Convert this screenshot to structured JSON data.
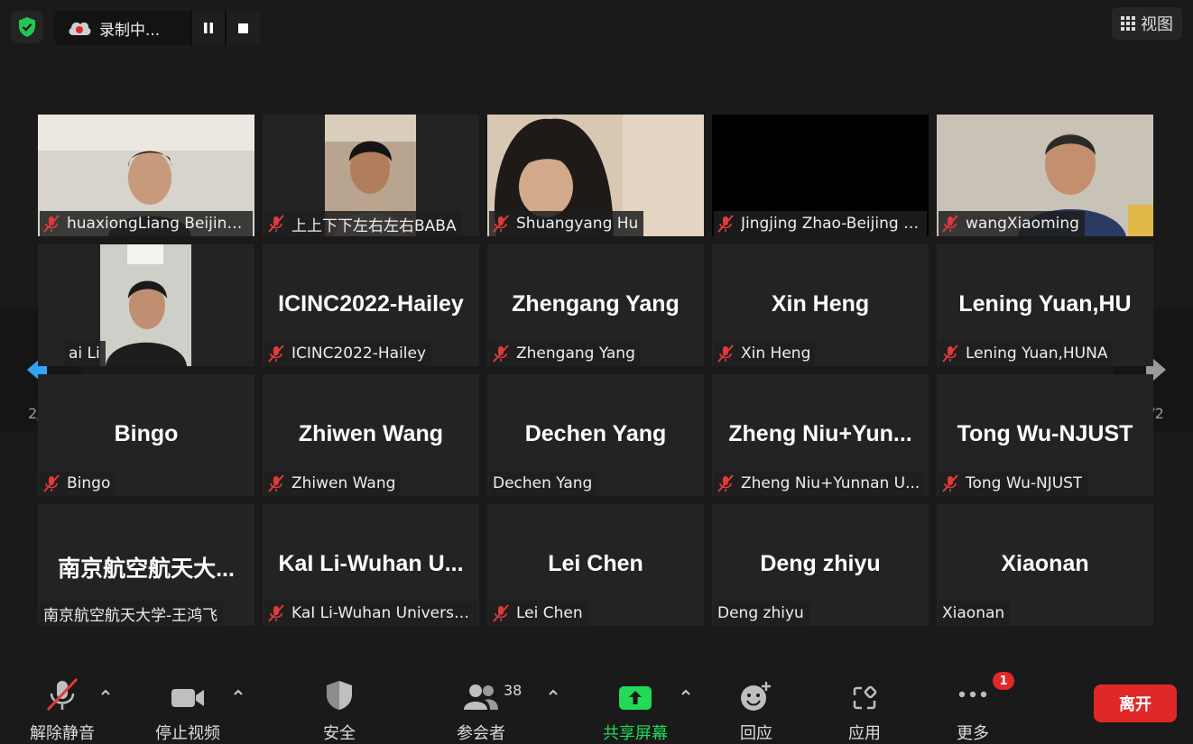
{
  "recording": {
    "label": "录制中..."
  },
  "view_button": {
    "label": "视图"
  },
  "pagination": {
    "left": "2/2",
    "right": "2/2"
  },
  "tiles": [
    {
      "name": "huaxiongLiang Beijing...",
      "muted": true,
      "video": true
    },
    {
      "name": "上上下下左右左右BABA",
      "muted": true,
      "video": true
    },
    {
      "name": "Shuangyang Hu",
      "muted": true,
      "video": true
    },
    {
      "name": "Jingjing Zhao-Beijing I...",
      "muted": true,
      "video": true
    },
    {
      "name": "wangXiaoming",
      "muted": true,
      "video": true
    },
    {
      "name": "ai Li",
      "muted": false,
      "video": true
    },
    {
      "big": "ICINC2022-Hailey",
      "name": "ICINC2022-Hailey",
      "muted": true
    },
    {
      "big": "Zhengang Yang",
      "name": "Zhengang Yang",
      "muted": true
    },
    {
      "big": "Xin Heng",
      "name": "Xin Heng",
      "muted": true
    },
    {
      "big": "Lening  Yuan,HU",
      "name": "Lening Yuan,HUNA",
      "muted": true
    },
    {
      "big": "Bingo",
      "name": "Bingo",
      "muted": true
    },
    {
      "big": "Zhiwen Wang",
      "name": "Zhiwen Wang",
      "muted": true
    },
    {
      "big": "Dechen Yang",
      "name": "Dechen Yang",
      "muted": false
    },
    {
      "big": "Zheng  Niu+Yun...",
      "name": "Zheng Niu+Yunnan U...",
      "muted": true
    },
    {
      "big": "Tong Wu-NJUST",
      "name": "Tong Wu-NJUST",
      "muted": true
    },
    {
      "big": "南京航空航天大...",
      "name": "南京航空航天大学-王鸿飞",
      "muted": false
    },
    {
      "big": "KaI  Li-Wuhan  U...",
      "name": "KaI Li-Wuhan Universi...",
      "muted": true
    },
    {
      "big": "Lei Chen",
      "name": "Lei Chen",
      "muted": true
    },
    {
      "big": "Deng zhiyu",
      "name": "Deng zhiyu",
      "muted": false
    },
    {
      "big": "Xiaonan",
      "name": "Xiaonan",
      "muted": false
    }
  ],
  "toolbar": {
    "unmute": "解除静音",
    "stop_video": "停止视频",
    "security": "安全",
    "participants": "参会者",
    "participants_count": "38",
    "share": "共享屏幕",
    "reactions": "回应",
    "apps": "应用",
    "more": "更多",
    "more_badge": "1",
    "leave": "离开"
  },
  "colors": {
    "share_green": "#23d959",
    "leave_red": "#e02828",
    "mute_red": "#e03a3a",
    "nav_blue": "#2ea7f2"
  }
}
